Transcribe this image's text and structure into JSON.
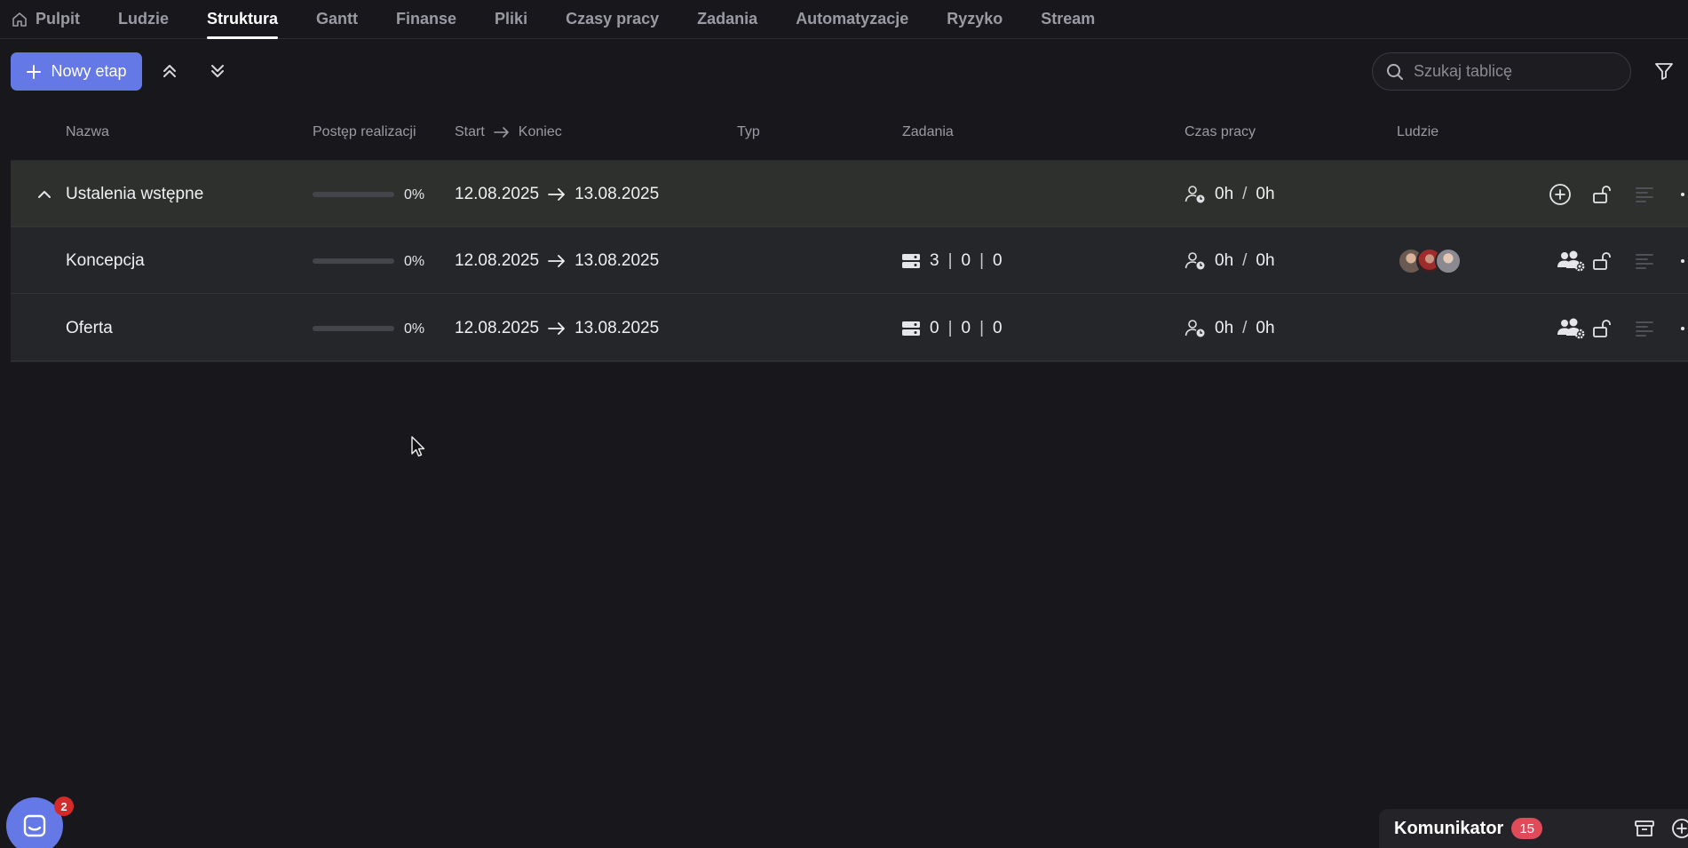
{
  "nav": {
    "tabs": [
      {
        "label": "Pulpit",
        "icon": "home-icon",
        "active": false
      },
      {
        "label": "Ludzie",
        "active": false
      },
      {
        "label": "Struktura",
        "active": true
      },
      {
        "label": "Gantt",
        "active": false
      },
      {
        "label": "Finanse",
        "active": false
      },
      {
        "label": "Pliki",
        "active": false
      },
      {
        "label": "Czasy pracy",
        "active": false
      },
      {
        "label": "Zadania",
        "active": false
      },
      {
        "label": "Automatyzacje",
        "active": false
      },
      {
        "label": "Ryzyko",
        "active": false
      },
      {
        "label": "Stream",
        "active": false
      }
    ]
  },
  "toolbar": {
    "new_stage_label": "Nowy etap",
    "collapse_all_icon": "chevrons-up-icon",
    "expand_all_icon": "chevrons-down-icon",
    "search_placeholder": "Szukaj tablicę",
    "filter_icon": "filter-icon"
  },
  "table": {
    "headers": {
      "name": "Nazwa",
      "progress": "Postęp realizacji",
      "start": "Start",
      "end": "Koniec",
      "type": "Typ",
      "tasks": "Zadania",
      "worktime": "Czas pracy",
      "people": "Ludzie"
    },
    "rows": [
      {
        "kind": "group",
        "name": "Ustalenia wstępne",
        "progress_value": 0,
        "progress": "0%",
        "start": "12.08.2025",
        "end": "13.08.2025",
        "type": "",
        "tasks": null,
        "worked": "0h",
        "planned": "0h",
        "people_count": 0
      },
      {
        "kind": "stage",
        "name": "Koncepcja",
        "progress_value": 0,
        "progress": "0%",
        "start": "12.08.2025",
        "end": "13.08.2025",
        "type": "",
        "tasks": {
          "a": "3",
          "b": "0",
          "c": "0"
        },
        "worked": "0h",
        "planned": "0h",
        "people_count": 3
      },
      {
        "kind": "stage",
        "name": "Oferta",
        "progress_value": 0,
        "progress": "0%",
        "start": "12.08.2025",
        "end": "13.08.2025",
        "type": "",
        "tasks": {
          "a": "0",
          "b": "0",
          "c": "0"
        },
        "worked": "0h",
        "planned": "0h",
        "people_count": 0
      }
    ]
  },
  "chat_launcher": {
    "badge": "2"
  },
  "komunikator": {
    "title": "Komunikator",
    "badge": "15"
  },
  "colors": {
    "accent": "#6478e6",
    "background": "#18181c",
    "badge_red": "#d42a2a"
  }
}
